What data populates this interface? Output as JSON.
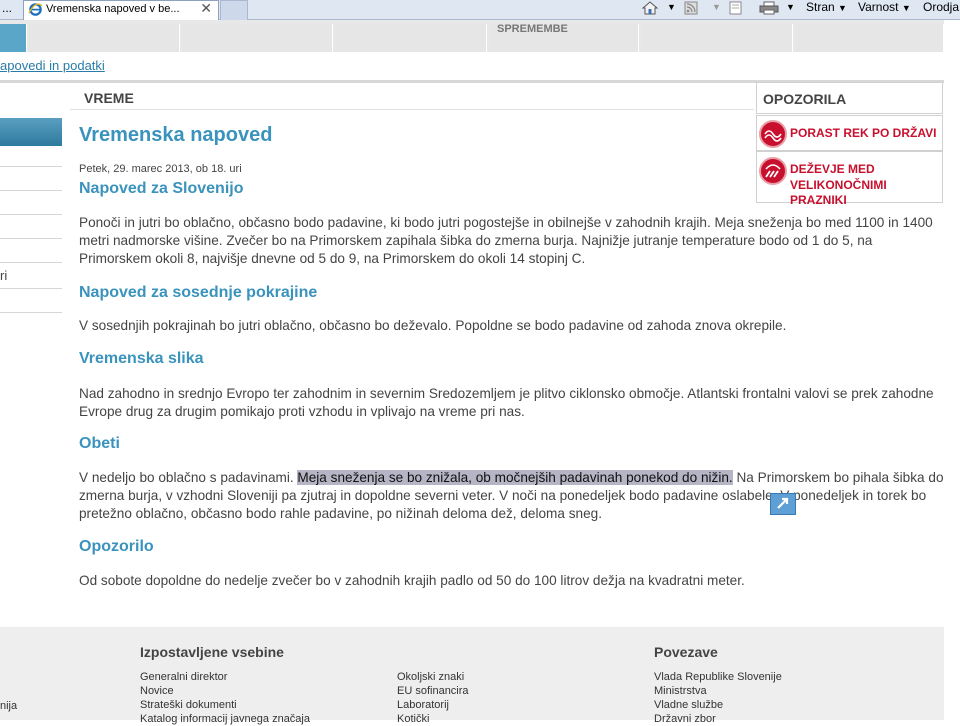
{
  "browser": {
    "prev_tab_label": "...",
    "active_tab_title": "Vremenska napoved v be...",
    "close_glyph": "✕",
    "commands": {
      "page": "Stran",
      "safety": "Varnost",
      "tools": "Orodja"
    }
  },
  "nav": {
    "item_label": "SPREMEMBE"
  },
  "breadcrumb": "apovedi in podatki",
  "left_sidebar": {
    "partial_label": "ri"
  },
  "section_header": "VREME",
  "article": {
    "title": "Vremenska napoved",
    "date": "Petek, 29. marec 2013, ob 18. uri",
    "sections": [
      {
        "heading": "Napoved za Slovenijo",
        "text": "Ponoči in jutri bo oblačno, občasno bodo padavine, ki bodo jutri pogostejše in obilnejše v zahodnih krajih. Meja sneženja bo med 1100 in 1400 metri nadmorske višine. Zvečer bo na Primorskem zapihala šibka do zmerna burja. Najnižje jutranje temperature bodo od 1 do 5, na Primorskem okoli 8, najvišje dnevne od 5 do 9, na Primorskem do okoli 14 stopinj C."
      },
      {
        "heading": "Napoved za sosednje pokrajine",
        "text": "V sosednjih pokrajinah bo jutri oblačno, občasno bo deževalo. Popoldne se bodo padavine od zahoda znova okrepile."
      },
      {
        "heading": "Vremenska slika",
        "text": "Nad zahodno in srednjo Evropo ter zahodnim in severnim Sredozemljem je plitvo ciklonsko območje. Atlantski frontalni valovi se prek zahodne Evrope drug za drugim pomikajo proti vzhodu in vplivajo na vreme pri nas."
      },
      {
        "heading": "Obeti",
        "text_before": "V nedeljo bo oblačno s padavinami. ",
        "text_highlighted": "Meja sneženja se bo znižala, ob močnejših padavinah ponekod do nižin.",
        "text_after": " Na Primorskem bo pihala šibka do zmerna burja, v vzhodni Sloveniji pa zjutraj in dopoldne severni veter. V noči na ponedeljek bodo padavine oslabele. V ponedeljek in torek bo pretežno oblačno, občasno bodo rahle padavine, po nižinah deloma dež, deloma sneg."
      },
      {
        "heading": "Opozorilo",
        "text": "Od sobote dopoldne do nedelje zvečer bo v zahodnih krajih padlo od 50 do 100 litrov dežja na kvadratni meter."
      }
    ]
  },
  "warnings": {
    "header": "OPOZORILA",
    "items": [
      {
        "line1": "PORAST REK PO DRŽAVI",
        "line2": ""
      },
      {
        "line1": "DEŽEVJE MED",
        "line2": "VELIKONOČNIMI PRAZNIKI"
      }
    ]
  },
  "footer": {
    "left_partial": "nija",
    "col1_heading": "Izpostavljene vsebine",
    "col1_links": [
      "Generalni direktor",
      "Novice",
      "Strateški dokumenti",
      "Katalog informacij javnega značaja"
    ],
    "col2_links": [
      "Okoljski znaki",
      "EU sofinancira",
      "Laboratorij",
      "Kotički"
    ],
    "col3_heading": "Povezave",
    "col3_links": [
      "Vlada Republike Slovenije",
      "Ministrstva",
      "Vladne službe",
      "Državni zbor"
    ]
  },
  "colors": {
    "heading_blue": "#3a93bd",
    "warning_red": "#c8102e",
    "highlight": "#b5b5c6"
  }
}
